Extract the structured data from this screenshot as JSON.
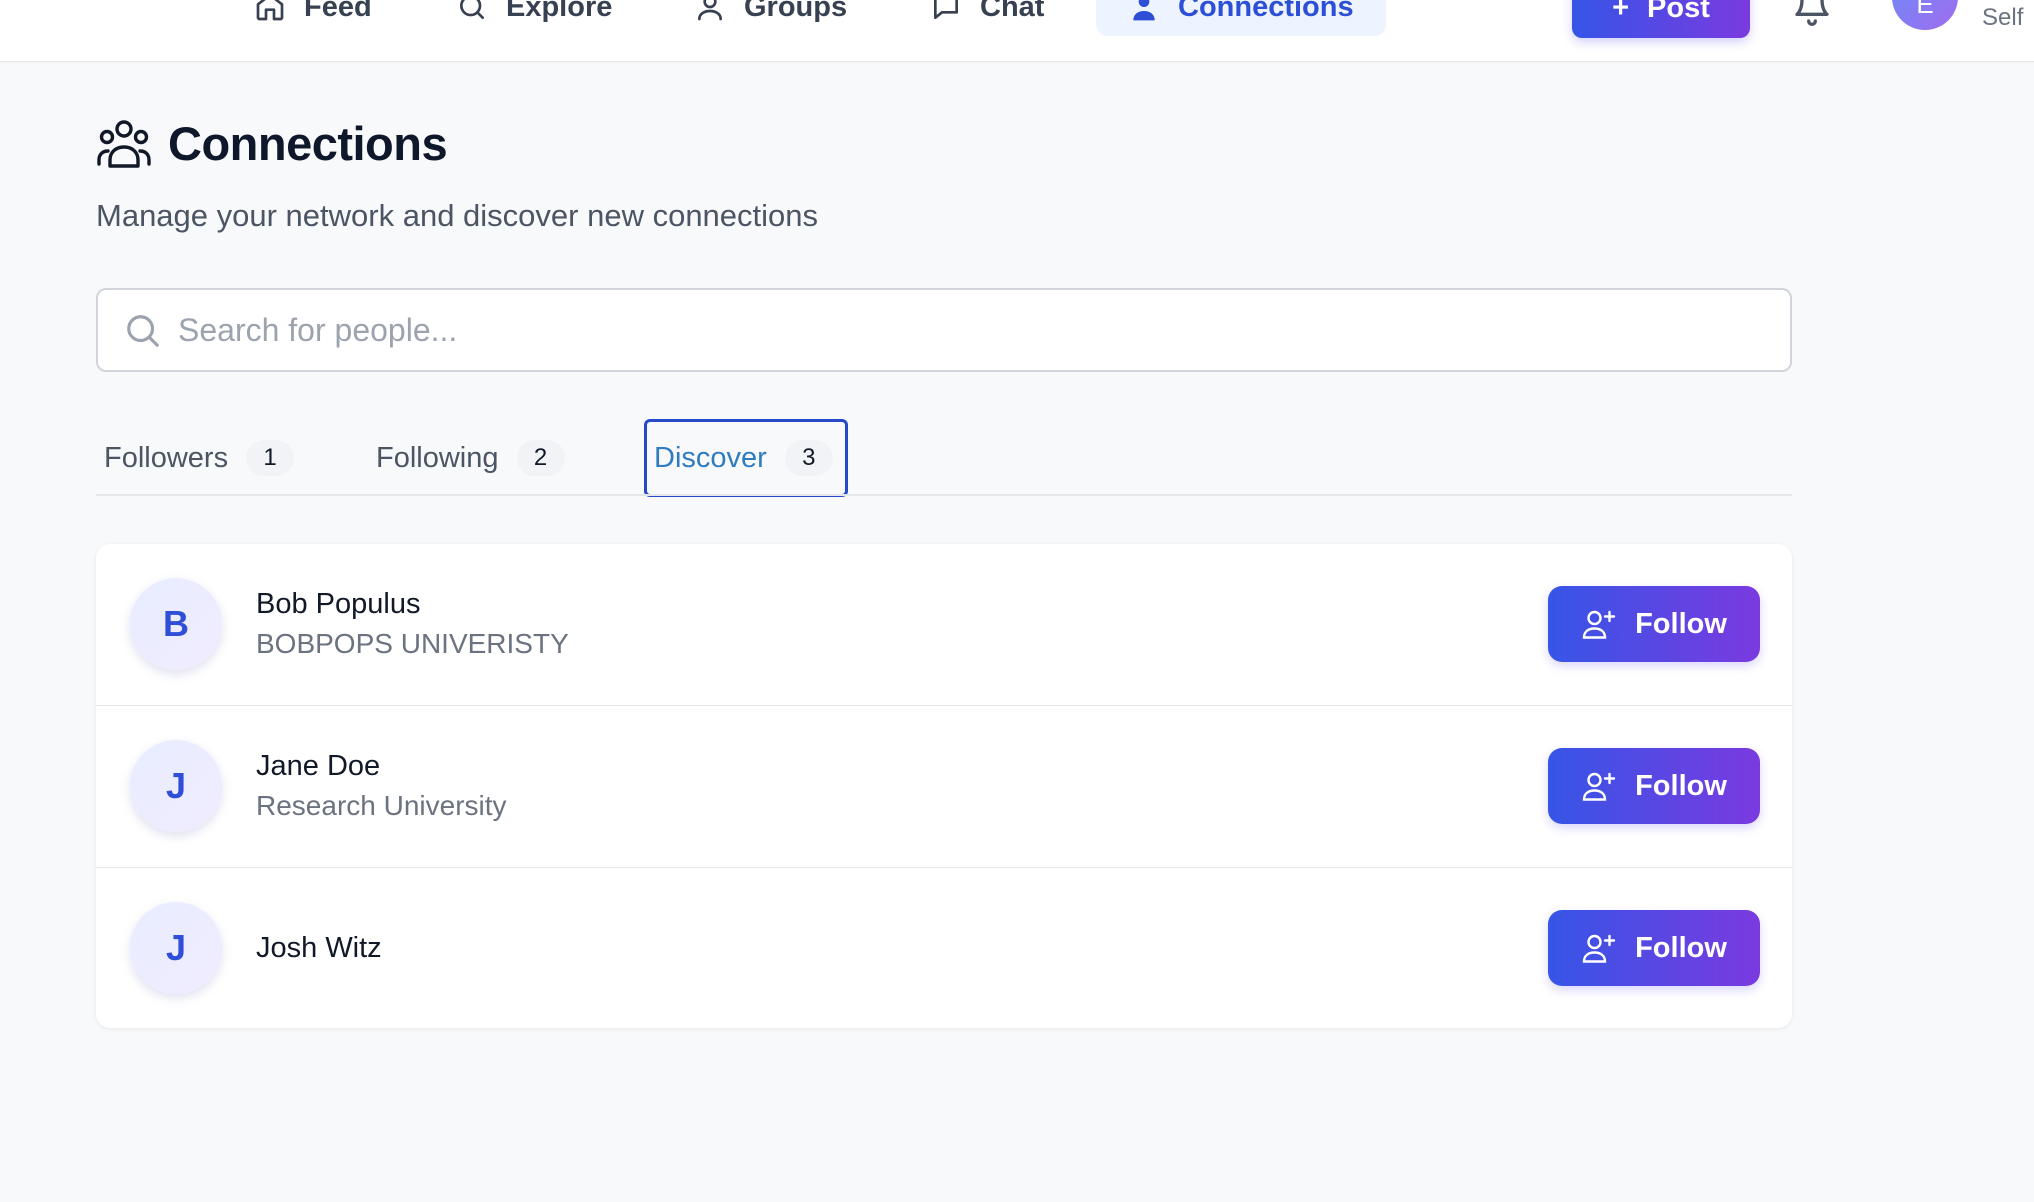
{
  "nav": {
    "items": [
      {
        "label": "Feed",
        "icon": "home-icon"
      },
      {
        "label": "Explore",
        "icon": "search-icon"
      },
      {
        "label": "Groups",
        "icon": "groups-icon"
      },
      {
        "label": "Chat",
        "icon": "chat-icon"
      },
      {
        "label": "Connections",
        "icon": "connections-icon",
        "active": true
      }
    ],
    "post_label": "Post",
    "avatar_initial": "E",
    "user_label": "Self"
  },
  "header": {
    "title": "Connections",
    "subtitle": "Manage your network and discover new connections"
  },
  "search": {
    "placeholder": "Search for people...",
    "value": ""
  },
  "tabs": [
    {
      "label": "Followers",
      "count": "1"
    },
    {
      "label": "Following",
      "count": "2"
    },
    {
      "label": "Discover",
      "count": "3",
      "active": true
    }
  ],
  "people": [
    {
      "initial": "B",
      "name": "Bob Populus",
      "affiliation": "BOBPOPS UNIVERISTY",
      "action": "Follow"
    },
    {
      "initial": "J",
      "name": "Jane Doe",
      "affiliation": "Research University",
      "action": "Follow"
    },
    {
      "initial": "J",
      "name": "Josh Witz",
      "affiliation": "",
      "action": "Follow"
    }
  ],
  "colors": {
    "accent_start": "#3655e6",
    "accent_end": "#7a3ae0",
    "active_tab_text": "#2f7cc0",
    "active_tab_border": "#2549c8",
    "background": "#f8f9fb"
  }
}
